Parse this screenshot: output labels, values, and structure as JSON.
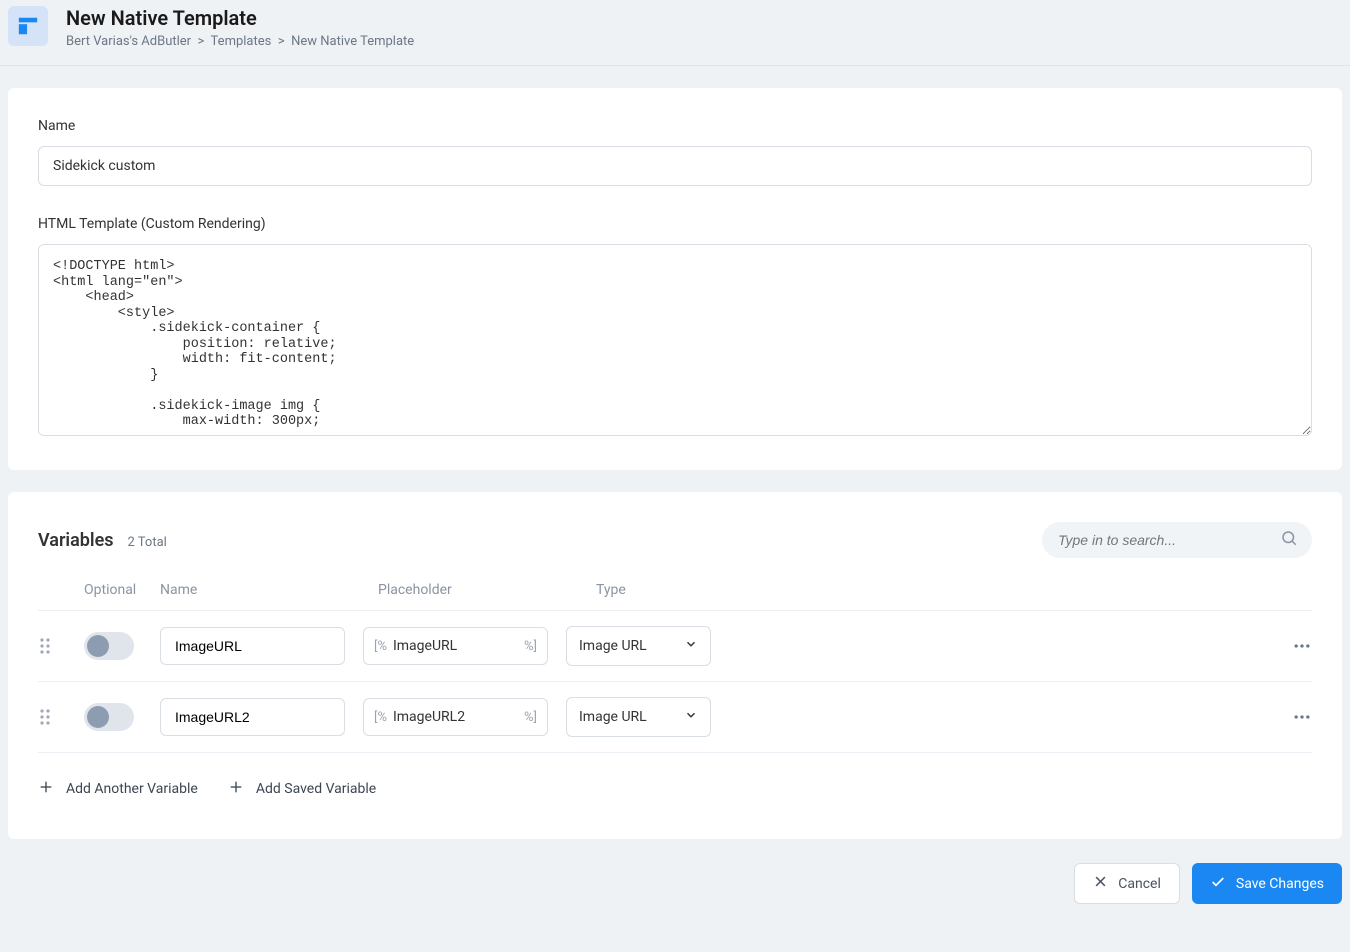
{
  "header": {
    "title": "New Native Template",
    "breadcrumbs": [
      "Bert Varias's AdButler",
      "Templates",
      "New Native Template"
    ]
  },
  "form": {
    "name_label": "Name",
    "name_value": "Sidekick custom",
    "html_label": "HTML Template (Custom Rendering)",
    "html_value": "<!DOCTYPE html>\n<html lang=\"en\">\n    <head>\n        <style>\n            .sidekick-container {\n                position: relative;\n                width: fit-content;\n            }\n\n            .sidekick-image img {\n                max-width: 300px;"
  },
  "variables": {
    "title": "Variables",
    "total_label": "2 Total",
    "search_placeholder": "Type in to search...",
    "headers": {
      "optional": "Optional",
      "name": "Name",
      "placeholder": "Placeholder",
      "type": "Type"
    },
    "rows": [
      {
        "name": "ImageURL",
        "placeholder": "ImageURL",
        "type": "Image URL"
      },
      {
        "name": "ImageURL2",
        "placeholder": "ImageURL2",
        "type": "Image URL"
      }
    ],
    "ph_open": "[%",
    "ph_close": "%]",
    "add_another": "Add Another Variable",
    "add_saved": "Add Saved Variable"
  },
  "actions": {
    "cancel": "Cancel",
    "save": "Save Changes"
  }
}
